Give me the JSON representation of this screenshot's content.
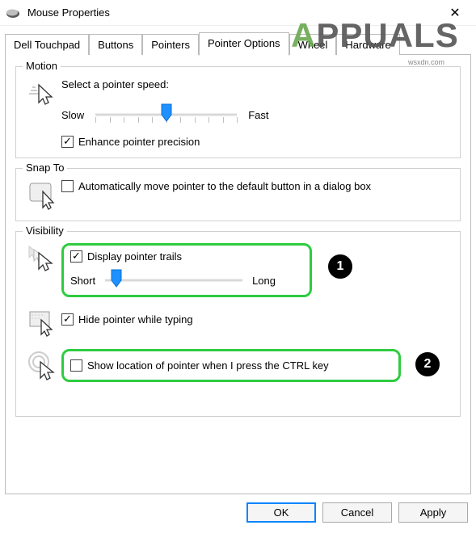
{
  "titlebar": {
    "title": "Mouse Properties",
    "close_glyph": "✕"
  },
  "watermark": {
    "text_a": "A",
    "text_rest": "PPUALS",
    "sub": "wsxdn.com"
  },
  "tabs": {
    "dell_touchpad": "Dell Touchpad",
    "buttons": "Buttons",
    "pointers": "Pointers",
    "pointer_options": "Pointer Options",
    "wheel": "Wheel",
    "hardware": "Hardware"
  },
  "motion": {
    "group_title": "Motion",
    "speed_label": "Select a pointer speed:",
    "slow": "Slow",
    "fast": "Fast",
    "enhance_precision": "Enhance pointer precision",
    "enhance_checked": true,
    "slider_pos_pct": 50
  },
  "snap_to": {
    "group_title": "Snap To",
    "label": "Automatically move pointer to the default button in a dialog box",
    "checked": false
  },
  "visibility": {
    "group_title": "Visibility",
    "trails_label": "Display pointer trails",
    "trails_checked": true,
    "short": "Short",
    "long": "Long",
    "trails_slider_pos_pct": 8,
    "hide_typing_label": "Hide pointer while typing",
    "hide_typing_checked": true,
    "ctrl_label": "Show location of pointer when I press the CTRL key",
    "ctrl_checked": false
  },
  "callouts": {
    "one": "1",
    "two": "2"
  },
  "buttons": {
    "ok": "OK",
    "cancel": "Cancel",
    "apply": "Apply"
  }
}
